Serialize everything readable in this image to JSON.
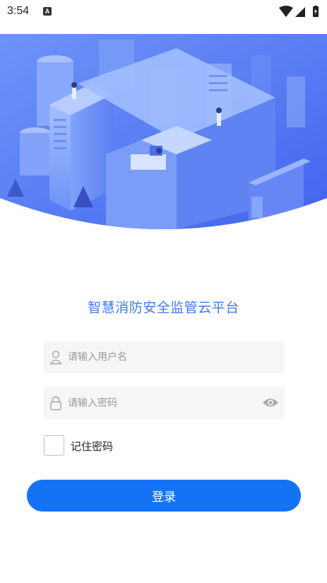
{
  "status_bar": {
    "time": "3:54",
    "notification_badge": "A"
  },
  "app_title": "智慧消防安全监管云平台",
  "login_form": {
    "username_placeholder": "请输入用户名",
    "password_placeholder": "请输入密码",
    "remember_label": "记住密码",
    "remember_checked": false,
    "login_button": "登录"
  },
  "colors": {
    "accent": "#3f79f0",
    "button": "#1473f5",
    "field_background": "#f6f6f6"
  },
  "icons": [
    "user-icon",
    "lock-icon",
    "eye-icon",
    "wifi-icon",
    "signal-icon",
    "battery-icon"
  ]
}
